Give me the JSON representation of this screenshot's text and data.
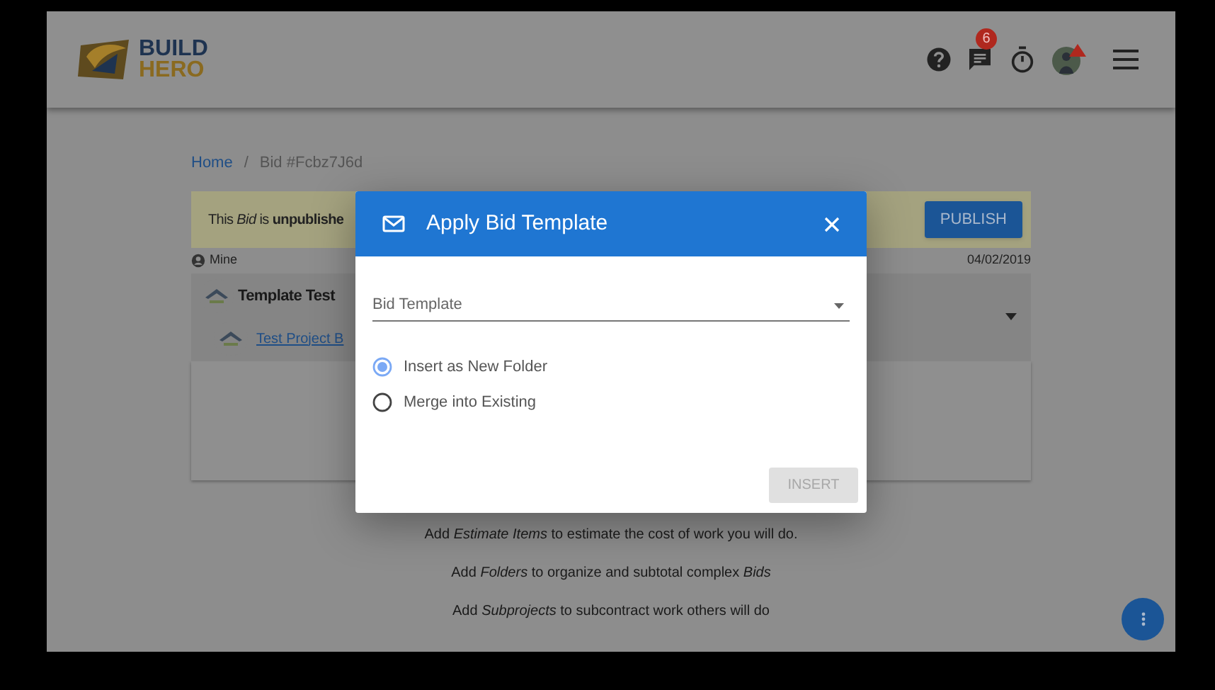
{
  "header": {
    "logo_line_1": "BUILD",
    "logo_line_2": "HERO",
    "notification_count": "6"
  },
  "breadcrumb": {
    "separator": "/",
    "items": [
      {
        "label": "Home",
        "kind": "link"
      },
      {
        "label": "Bid #Fcbz7J6d",
        "kind": "current"
      }
    ]
  },
  "banner": {
    "message": "This *Bid* is **unpublishe**",
    "button": "PUBLISH"
  },
  "owner": "Mine",
  "date": "04/02/2019",
  "folder": {
    "title": "Template Test",
    "project_link": "Test Project B"
  },
  "hints": [
    "Add *Estimate Items* to estimate the cost of work you will do.",
    "Add *Folders* to organize and subtotal complex *Bids*",
    "Add *Subprojects* to subcontract work others will do"
  ],
  "dialog": {
    "title": "Apply Bid Template",
    "field": {
      "placeholder": "Bid Template"
    },
    "options": [
      {
        "label": "Insert as New Folder",
        "selected": true
      },
      {
        "label": "Merge into Existing",
        "selected": false
      }
    ],
    "button": {
      "label": "INSERT",
      "disabled": true
    }
  }
}
